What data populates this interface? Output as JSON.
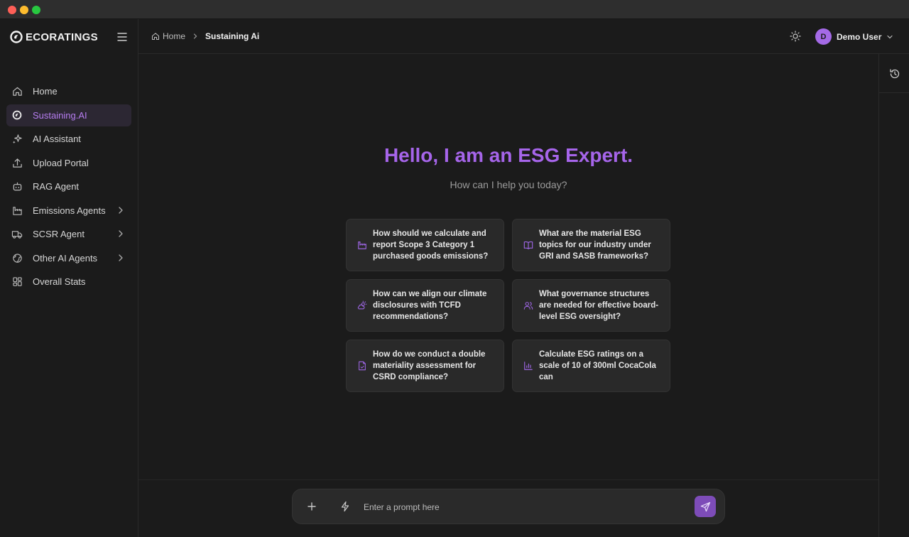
{
  "window": {
    "controls": [
      "close",
      "minimize",
      "maximize"
    ]
  },
  "brand": {
    "name": "ECORATINGS",
    "accent": "#a665ea"
  },
  "sidebar": {
    "items": [
      {
        "label": "Home",
        "icon": "home-icon",
        "has_children": false,
        "active": false
      },
      {
        "label": "Sustaining.AI",
        "icon": "logo-icon",
        "has_children": false,
        "active": true
      },
      {
        "label": "AI Assistant",
        "icon": "sparkles-icon",
        "has_children": false,
        "active": false
      },
      {
        "label": "Upload Portal",
        "icon": "upload-icon",
        "has_children": false,
        "active": false
      },
      {
        "label": "RAG Agent",
        "icon": "bot-icon",
        "has_children": false,
        "active": false
      },
      {
        "label": "Emissions Agents",
        "icon": "factory-icon",
        "has_children": true,
        "active": false
      },
      {
        "label": "SCSR Agent",
        "icon": "truck-icon",
        "has_children": true,
        "active": false
      },
      {
        "label": "Other AI Agents",
        "icon": "globe-icon",
        "has_children": true,
        "active": false
      },
      {
        "label": "Overall Stats",
        "icon": "grid-icon",
        "has_children": false,
        "active": false
      }
    ]
  },
  "breadcrumb": {
    "home": "Home",
    "current": "Sustaining Ai"
  },
  "user": {
    "initial": "D",
    "name": "Demo User"
  },
  "hero": {
    "title": "Hello, I am an ESG Expert.",
    "subtitle": "How can I help you today?"
  },
  "suggestions": [
    {
      "text": "How should we calculate and report Scope 3 Category 1 purchased goods emissions?",
      "icon": "factory-icon"
    },
    {
      "text": "What are the material ESG topics for our industry under GRI and SASB frameworks?",
      "icon": "book-icon"
    },
    {
      "text": "How can we align our climate disclosures with TCFD recommendations?",
      "icon": "cloud-sun-icon"
    },
    {
      "text": "What governance structures are needed for effective board-level ESG oversight?",
      "icon": "users-icon"
    },
    {
      "text": "How do we conduct a double materiality assessment for CSRD compliance?",
      "icon": "document-icon"
    },
    {
      "text": "Calculate ESG ratings on a scale of 10 of 300ml CocaCola can",
      "icon": "bar-chart-icon"
    }
  ],
  "prompt": {
    "placeholder": "Enter a prompt here"
  }
}
